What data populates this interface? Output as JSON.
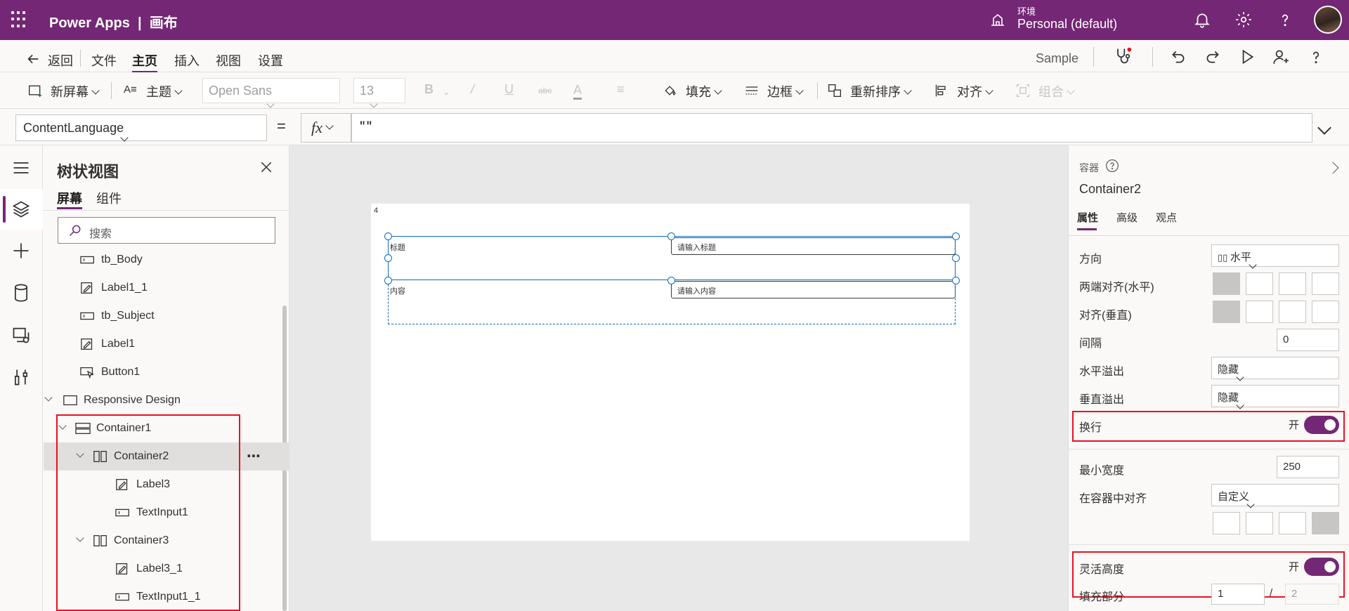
{
  "app": {
    "product": "Power Apps",
    "canvas_label": "画布",
    "env_label": "环境",
    "env_value": "Personal (default)"
  },
  "menu": {
    "back": "返回",
    "items": [
      "文件",
      "主页",
      "插入",
      "视图",
      "设置"
    ],
    "active": "主页",
    "app_name": "Sample"
  },
  "toolbar": {
    "new_screen": "新屏幕",
    "theme": "主题",
    "font": "Open Sans",
    "font_size": "13",
    "fill": "填充",
    "border": "边框",
    "reorder": "重新排序",
    "align": "对齐",
    "group": "组合"
  },
  "formula": {
    "property": "ContentLanguage",
    "equals": "=",
    "fx": "fx",
    "value": "\"\""
  },
  "tree": {
    "title": "树状视图",
    "tabs": [
      "屏幕",
      "组件"
    ],
    "search_placeholder": "搜索",
    "items": [
      "tb_Body",
      "Label1_1",
      "tb_Subject",
      "Label1",
      "Button1",
      "Responsive Design",
      "Container1",
      "Container2",
      "Label3",
      "TextInput1",
      "Container3",
      "Label3_1",
      "TextInput1_1"
    ],
    "more": "⋯"
  },
  "canvas": {
    "screen_index": "4",
    "label_title": "标题",
    "input_title": "请输入标题",
    "label_content": "内容",
    "input_content": "请输入内容"
  },
  "props": {
    "type_label": "容器",
    "name": "Container2",
    "tabs": [
      "属性",
      "高级",
      "观点"
    ],
    "direction_label": "方向",
    "direction_value": "水平",
    "justify_label": "两端对齐(水平)",
    "align_label": "对齐(垂直)",
    "gap_label": "间隔",
    "gap_value": "0",
    "hoverflow_label": "水平溢出",
    "hoverflow_value": "隐藏",
    "voverflow_label": "垂直溢出",
    "voverflow_value": "隐藏",
    "wrap_label": "换行",
    "wrap_state": "开",
    "minwidth_label": "最小宽度",
    "minwidth_value": "250",
    "alignin_label": "在容器中对齐",
    "alignin_value": "自定义",
    "flexheight_label": "灵活高度",
    "flexheight_state": "开",
    "fillportion_label": "填充部分",
    "fillportion_value": "1",
    "fillportion_of": "2",
    "slash": "/"
  },
  "colors": {
    "brand": "#742774",
    "selection": "#0f6cbd",
    "highlight": "#e81123"
  }
}
